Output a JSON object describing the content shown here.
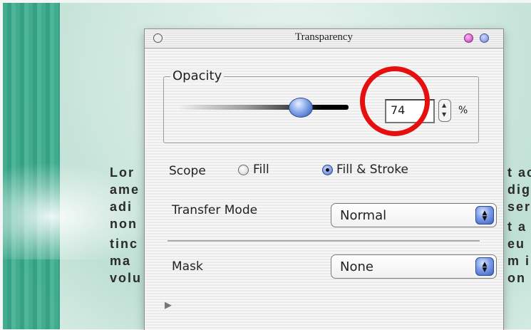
{
  "background_doc": {
    "left_fragments": [
      "Lor",
      "ame",
      "adi",
      "non",
      "tinc",
      "ma",
      "volu"
    ],
    "right_fragments": [
      "t ac",
      "dign",
      "ser",
      "t a",
      "eu",
      "m i",
      "on"
    ]
  },
  "palette": {
    "title": "Transparency",
    "opacity": {
      "group_label": "Opacity",
      "value": "74",
      "unit": "%",
      "level_percent": 74
    },
    "scope": {
      "label": "Scope",
      "options": [
        {
          "label": "Fill",
          "selected": false
        },
        {
          "label": "Fill & Stroke",
          "selected": true
        }
      ]
    },
    "transfer_mode": {
      "label": "Transfer Mode",
      "selected": "Normal"
    },
    "mask": {
      "label": "Mask",
      "selected": "None"
    }
  },
  "annotation": {
    "color": "#e60f0f"
  }
}
